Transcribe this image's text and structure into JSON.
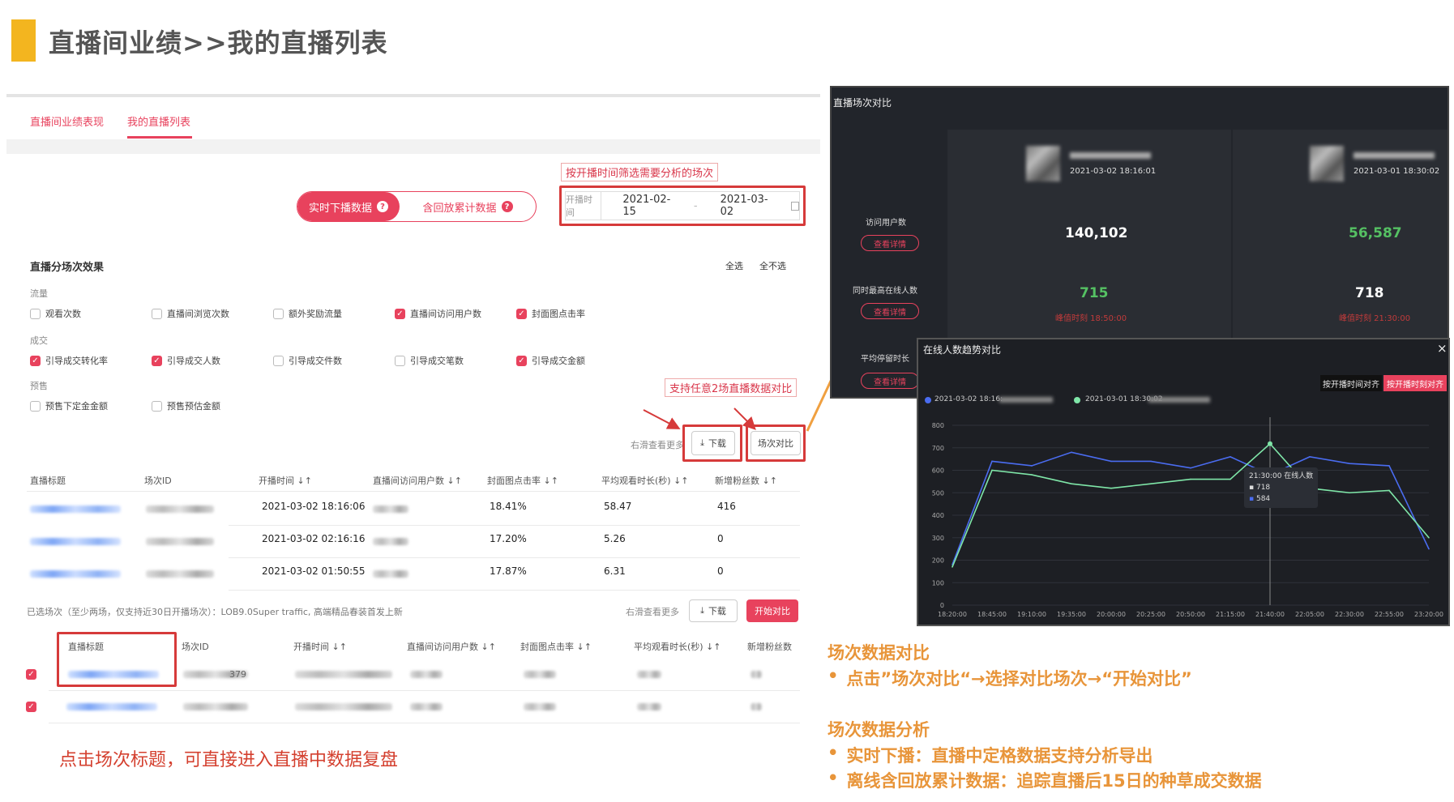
{
  "header": {
    "title": "直播间业绩>>我的直播列表"
  },
  "tabs": [
    {
      "label": "直播间业绩表现",
      "active": false
    },
    {
      "label": "我的直播列表",
      "active": true
    }
  ],
  "annotations": {
    "filter_hint": "按开播时间筛选需要分析的场次",
    "compare_hint": "支持任意2场直播数据对比",
    "bottom_caption": "点击场次标题，可直接进入直播中数据复盘"
  },
  "mode_toggle": {
    "realtime": "实时下播数据",
    "cumulative": "含回放累计数据"
  },
  "date_filter": {
    "label": "开播时间",
    "start": "2021-02-15",
    "separator": "-",
    "end": "2021-03-02"
  },
  "metrics_section": {
    "title": "直播分场次效果",
    "select_all": "全选",
    "select_none": "全不选",
    "groups": [
      {
        "name": "流量",
        "items": [
          {
            "label": "观看次数",
            "checked": false
          },
          {
            "label": "直播间浏览次数",
            "checked": false
          },
          {
            "label": "额外奖励流量",
            "checked": false
          },
          {
            "label": "直播间访问用户数",
            "checked": true
          },
          {
            "label": "封面图点击率",
            "checked": true
          }
        ]
      },
      {
        "name": "成交",
        "items": [
          {
            "label": "引导成交转化率",
            "checked": true
          },
          {
            "label": "引导成交人数",
            "checked": true
          },
          {
            "label": "引导成交件数",
            "checked": false
          },
          {
            "label": "引导成交笔数",
            "checked": false
          },
          {
            "label": "引导成交金额",
            "checked": true
          }
        ]
      },
      {
        "name": "预售",
        "items": [
          {
            "label": "预售下定金金额",
            "checked": false
          },
          {
            "label": "预售预估金额",
            "checked": false
          }
        ]
      }
    ]
  },
  "toolbar": {
    "scroll_hint": "右滑查看更多",
    "download": "下载",
    "compare": "场次对比",
    "start_compare": "开始对比"
  },
  "table": {
    "columns": [
      "直播标题",
      "场次ID",
      "开播时间",
      "直播间访问用户数",
      "封面图点击率",
      "平均观看时长(秒)",
      "新增粉丝数"
    ],
    "rows": [
      {
        "time": "2021-03-02 18:16:06",
        "ctr": "18.41%",
        "avg": "58.47",
        "fans": "416"
      },
      {
        "time": "2021-03-02 02:16:16",
        "ctr": "17.20%",
        "avg": "5.26",
        "fans": "0"
      },
      {
        "time": "2021-03-02 01:50:55",
        "ctr": "17.87%",
        "avg": "6.31",
        "fans": "0"
      }
    ]
  },
  "selection": {
    "note": "已选场次（至少两场，仅支持近30日开播场次）：LOB9.0Super traffic, 高端精品春装首发上新",
    "columns": [
      "直播标题",
      "场次ID",
      "开播时间",
      "直播间访问用户数",
      "封面图点击率",
      "平均观看时长(秒)",
      "新增粉丝数"
    ],
    "partial_id": "379"
  },
  "right_notes": {
    "h1": "场次数据对比",
    "b1": "点击”场次对比“→选择对比场次→“开始对比”",
    "h2": "场次数据分析",
    "b2": "实时下播：直播中定格数据支持分析导出",
    "b3": "离线含回放累计数据：追踪直播后15日的种草成交数据"
  },
  "compare_panel": {
    "title": "直播场次对比",
    "sessions": [
      {
        "time": "2021-03-02 18:16:01",
        "visitors": "140,102",
        "peak": "715",
        "peak_time": "峰值时刻 18:50:00",
        "visitors_color": "#ffffff",
        "peak_color": "#55c163"
      },
      {
        "time": "2021-03-01 18:30:02",
        "visitors": "56,587",
        "peak": "718",
        "peak_time": "峰值时刻 21:30:00",
        "visitors_color": "#55c163",
        "peak_color": "#ffffff"
      }
    ],
    "row_labels": [
      "访问用户数",
      "同时最高在线人数",
      "平均停留时长"
    ],
    "detail_btn": "查看详情"
  },
  "trend_panel": {
    "title": "在线人数趋势对比",
    "close": "×",
    "align_start": "按开播时间对齐",
    "align_time": "按开播时刻对齐",
    "legend": [
      "2021-03-02 18:16:",
      "2021-03-01 18:30:02"
    ],
    "tooltip": {
      "time": "21:30:00 在线人数",
      "v1": "718",
      "v2": "584"
    }
  },
  "chart_data": {
    "type": "line",
    "x": [
      "18:20:00",
      "18:45:00",
      "19:10:00",
      "19:35:00",
      "20:00:00",
      "20:25:00",
      "20:50:00",
      "21:15:00",
      "21:40:00",
      "22:05:00",
      "22:30:00",
      "22:55:00",
      "23:20:00"
    ],
    "yticks": [
      "0",
      "100",
      "200",
      "300",
      "400",
      "500",
      "600",
      "700",
      "800"
    ],
    "ylim": [
      0,
      800
    ],
    "series": [
      {
        "name": "2021-03-02 18:16:",
        "color": "#4a6cf0",
        "values": [
          180,
          640,
          620,
          680,
          640,
          640,
          610,
          660,
          580,
          660,
          630,
          620,
          250
        ]
      },
      {
        "name": "2021-03-01 18:30:02",
        "color": "#7fe6a8",
        "values": [
          170,
          600,
          580,
          540,
          520,
          540,
          560,
          560,
          718,
          520,
          500,
          510,
          300
        ]
      }
    ]
  }
}
